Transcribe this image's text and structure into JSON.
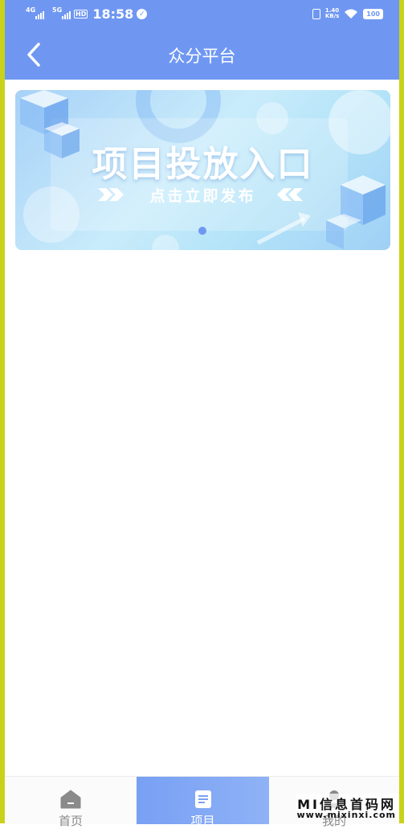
{
  "status_bar": {
    "net1": "4G",
    "net2": "5G",
    "hd": "HD",
    "time": "18:58",
    "speed_value": "1.40",
    "speed_unit": "KB/s",
    "battery": "100"
  },
  "header": {
    "title": "众分平台",
    "background": "#6f97f2"
  },
  "banner": {
    "title": "项目投放入口",
    "subtitle": "点击立即发布",
    "page_indicator": {
      "current": 1,
      "total": 1
    }
  },
  "bottom_nav": {
    "items": [
      {
        "label": "首页",
        "icon": "home-icon",
        "active": false
      },
      {
        "label": "项目",
        "icon": "document-icon",
        "active": true
      },
      {
        "label": "我的",
        "icon": "user-icon",
        "active": false
      }
    ],
    "active_color": "#7aa2f4"
  },
  "watermark": {
    "text": "MI信息首码网",
    "url": "www.mixinxi.com"
  },
  "frame_color": "#c9d21a"
}
